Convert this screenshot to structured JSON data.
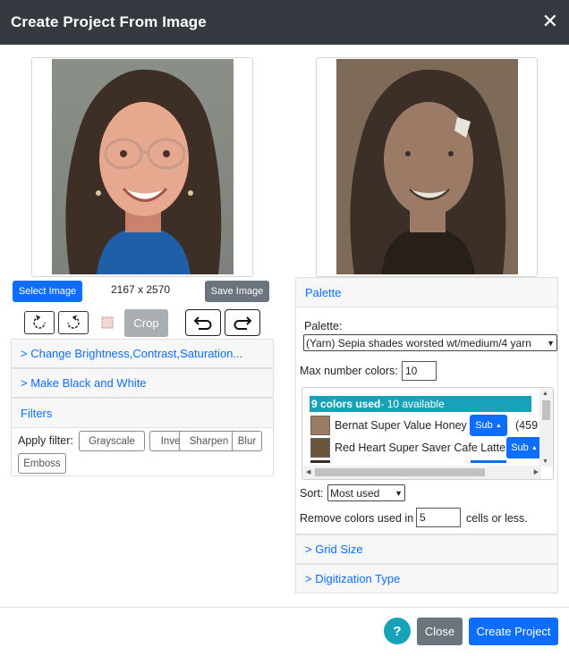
{
  "dialog": {
    "title": "Create Project From Image",
    "close_glyph": "✕"
  },
  "left": {
    "select_image_label": "Select Image",
    "dimensions": "2167 x 2570",
    "save_image_label": "Save Image",
    "crop_label": "Crop",
    "brightness_label": "> Change Brightness,Contrast,Saturation...",
    "black_white_label": "> Make Black and White",
    "filters_label": "Filters",
    "apply_filter_label": "Apply filter:",
    "filters": [
      "Grayscale",
      "Invert",
      "Sharpen",
      "Blur",
      "Emboss"
    ]
  },
  "right": {
    "palette_header": "Palette",
    "palette_label": "Palette:",
    "palette_value": "(Yarn) Sepia shades worsted wt/medium/4 yarn",
    "max_colors_label": "Max number colors:",
    "max_colors_value": "10",
    "colors_used_bold": "9 colors used",
    "colors_available": " - 10 available",
    "colors": [
      {
        "name": "Bernat Super Value Honey",
        "sub": "Sub",
        "extra": "(459",
        "color": "#9c7b66"
      },
      {
        "name": "Red Heart Super Saver Cafe Latte",
        "sub": "Sub",
        "extra": "",
        "color": "#6b533e"
      }
    ],
    "sort_label": "Sort:",
    "sort_value": "Most used",
    "remove_label": "Remove colors used in",
    "remove_value": "5",
    "remove_suffix": "cells or less.",
    "grid_size_label": "> Grid Size",
    "digitization_label": "> Digitization Type"
  },
  "footer": {
    "help_label": "?",
    "close_label": "Close",
    "create_label": "Create Project"
  }
}
